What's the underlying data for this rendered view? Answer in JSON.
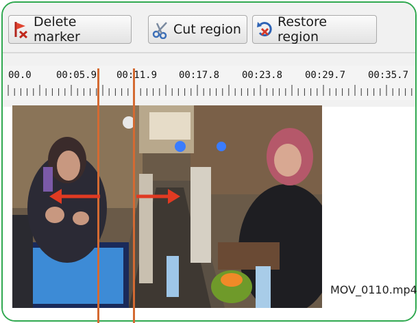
{
  "toolbar": {
    "delete_marker": {
      "label": "Delete marker",
      "icon": "delete-marker-icon"
    },
    "cut_region": {
      "label": "Cut region",
      "icon": "scissors-icon"
    },
    "restore_region": {
      "label": "Restore region",
      "icon": "restore-icon"
    }
  },
  "ruler": {
    "labels": [
      "00.0",
      "00:05.9",
      "00:11.9",
      "00:17.8",
      "00:23.8",
      "00:29.7",
      "00:35.7"
    ]
  },
  "clip": {
    "filename": "MOV_0110.mp4"
  },
  "colors": {
    "frame_border": "#2fa84f",
    "marker": "#d46a32",
    "arrow": "#e03a22"
  }
}
